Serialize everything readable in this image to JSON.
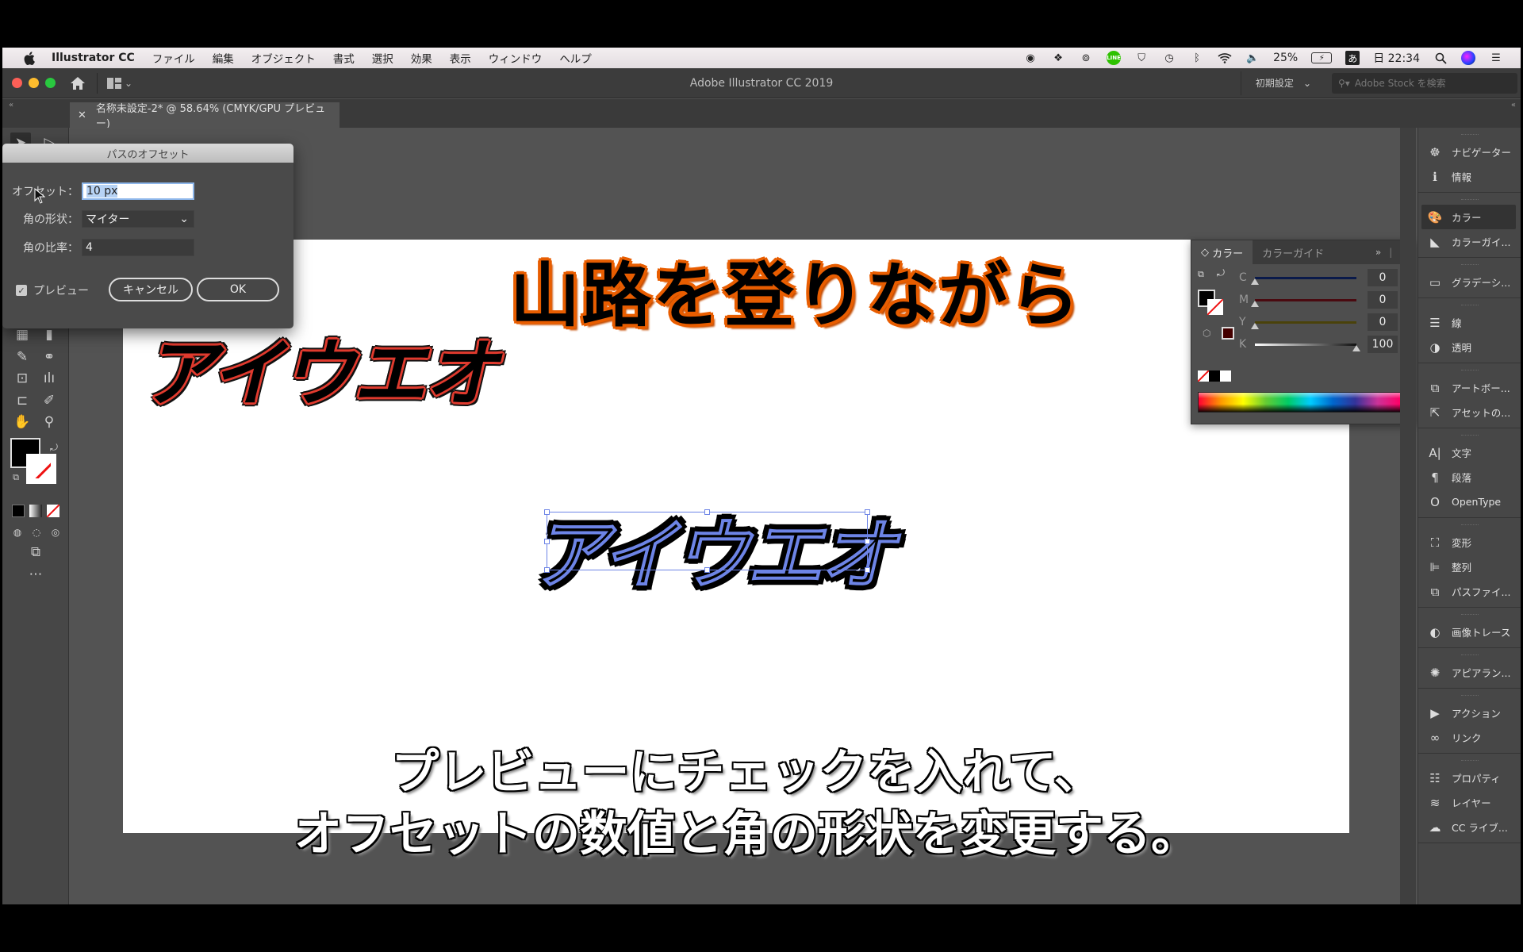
{
  "menubar": {
    "app_name": "Illustrator CC",
    "menus": [
      "ファイル",
      "編集",
      "オブジェクト",
      "書式",
      "選択",
      "効果",
      "表示",
      "ウィンドウ",
      "ヘルプ"
    ],
    "status": {
      "battery": "25%",
      "ime": "あ",
      "clock": "日 22:34",
      "line_badge": "LINE"
    }
  },
  "titlebar": {
    "window_title": "Adobe Illustrator CC 2019",
    "workspace": "初期設定",
    "stock_search_placeholder": "Adobe Stock を検索"
  },
  "document_tab": {
    "label": "名称未設定-2* @ 58.64% (CMYK/GPU プレビュー)"
  },
  "artwork": {
    "orange_text": "山路を登りながら",
    "red_text": "アイウエオ",
    "selected_text": "アイウエオ",
    "colors": {
      "orange_stroke": "#e85d00",
      "red_stroke": "#e03a2e",
      "selection": "#6d84e6"
    }
  },
  "subtitles": {
    "line1": "プレビューにチェックを入れて、",
    "line2": "オフセットの数値と角の形状を変更する。"
  },
  "offset_dialog": {
    "title": "パスのオフセット",
    "offset_label": "オフセット：",
    "offset_value": "10 px",
    "joins_label": "角の形状：",
    "joins_value": "マイター",
    "miter_label": "角の比率：",
    "miter_value": "4",
    "preview_label": "プレビュー",
    "preview_checked": true,
    "cancel_label": "キャンセル",
    "ok_label": "OK"
  },
  "color_panel": {
    "tabs": [
      "カラー",
      "カラーガイド"
    ],
    "sliders": [
      {
        "label": "C",
        "value": "0",
        "unit": "%",
        "track": "#0a1a4a"
      },
      {
        "label": "M",
        "value": "0",
        "unit": "%",
        "track": "#4a0a10"
      },
      {
        "label": "Y",
        "value": "0",
        "unit": "%",
        "track": "#4a420a"
      },
      {
        "label": "K",
        "value": "100",
        "unit": "%",
        "track": "linear-gradient(to right,#fff,#111)"
      }
    ],
    "k_fraction": 1.0
  },
  "dock": {
    "groups": [
      [
        {
          "icon": "navigator-icon",
          "glyph": "☸",
          "label": "ナビゲーター"
        },
        {
          "icon": "info-icon",
          "glyph": "ℹ",
          "label": "情報"
        }
      ],
      [
        {
          "icon": "color-palette-icon",
          "glyph": "🎨",
          "label": "カラー",
          "active": true
        },
        {
          "icon": "color-guide-icon",
          "glyph": "◣",
          "label": "カラーガイ..."
        }
      ],
      [
        {
          "icon": "gradient-icon",
          "glyph": "▭",
          "label": "グラデーシ..."
        }
      ],
      [
        {
          "icon": "stroke-icon",
          "glyph": "☰",
          "label": "線"
        },
        {
          "icon": "transparency-icon",
          "glyph": "◑",
          "label": "透明"
        }
      ],
      [
        {
          "icon": "artboards-icon",
          "glyph": "⧉",
          "label": "アートボー..."
        },
        {
          "icon": "asset-export-icon",
          "glyph": "⇱",
          "label": "アセットの..."
        }
      ],
      [
        {
          "icon": "character-icon",
          "glyph": "A|",
          "label": "文字"
        },
        {
          "icon": "paragraph-icon",
          "glyph": "¶",
          "label": "段落"
        },
        {
          "icon": "opentype-icon",
          "glyph": "O",
          "label": "OpenType"
        }
      ],
      [
        {
          "icon": "transform-icon",
          "glyph": "⛶",
          "label": "変形"
        },
        {
          "icon": "align-icon",
          "glyph": "⊫",
          "label": "整列"
        },
        {
          "icon": "pathfinder-icon",
          "glyph": "⧉",
          "label": "パスファイ..."
        }
      ],
      [
        {
          "icon": "image-trace-icon",
          "glyph": "◐",
          "label": "画像トレース"
        }
      ],
      [
        {
          "icon": "appearance-icon",
          "glyph": "✺",
          "label": "アピアラン..."
        }
      ],
      [
        {
          "icon": "actions-icon",
          "glyph": "▶",
          "label": "アクション"
        },
        {
          "icon": "links-icon",
          "glyph": "∞",
          "label": "リンク"
        }
      ],
      [
        {
          "icon": "properties-icon",
          "glyph": "☷",
          "label": "プロパティ"
        },
        {
          "icon": "layers-icon",
          "glyph": "≋",
          "label": "レイヤー"
        },
        {
          "icon": "cc-libraries-icon",
          "glyph": "☁",
          "label": "CC ライブ..."
        }
      ]
    ]
  }
}
